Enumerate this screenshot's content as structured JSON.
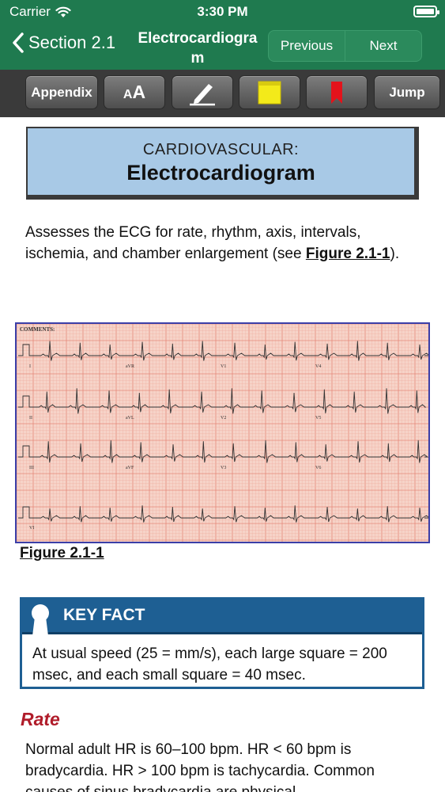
{
  "status_bar": {
    "carrier": "Carrier",
    "time": "3:30 PM"
  },
  "nav": {
    "back_label": "Section 2.1",
    "title": "Electrocardiogram",
    "previous_label": "Previous",
    "next_label": "Next"
  },
  "toolbar": {
    "appendix_label": "Appendix",
    "font_size_label": "AA",
    "pen_icon": "pen-icon",
    "note_icon": "sticky-note-icon",
    "bookmark_icon": "bookmark-icon",
    "jump_label": "Jump"
  },
  "content": {
    "category": "CARDIOVASCULAR:",
    "heading": "Electrocardiogram",
    "intro_text": "Assesses the ECG for rate, rhythm, axis, intervals, ischemia, and chamber enlargement (see ",
    "intro_link": "Figure 2.1-1",
    "intro_end": ").",
    "figure": {
      "caption": "Figure 2.1-1",
      "comments_label": "COMMENTS:",
      "leads": [
        [
          "I",
          "aVR",
          "V1",
          "V4"
        ],
        [
          "II",
          "aVL",
          "V2",
          "V5"
        ],
        [
          "III",
          "aVF",
          "V3",
          "V6"
        ]
      ],
      "rhythm_lead": "VI"
    },
    "key_fact": {
      "title": "KEY FACT",
      "text": "At usual speed (25 = mm/s), each large square = 200 msec, and each small square = 40 msec."
    },
    "rate_heading": "Rate",
    "rate_text": "Normal adult HR is 60–100 bpm. HR < 60 bpm is bradycardia. HR > 100 bpm is tachycardia. Common causes of sinus bradycardia are physical"
  },
  "colors": {
    "nav_green": "#1f7a4f",
    "title_box_blue": "#a8c9e6",
    "key_fact_blue": "#1e5f93",
    "rate_red": "#b01c2a",
    "ecg_paper": "#f6d3c8"
  }
}
